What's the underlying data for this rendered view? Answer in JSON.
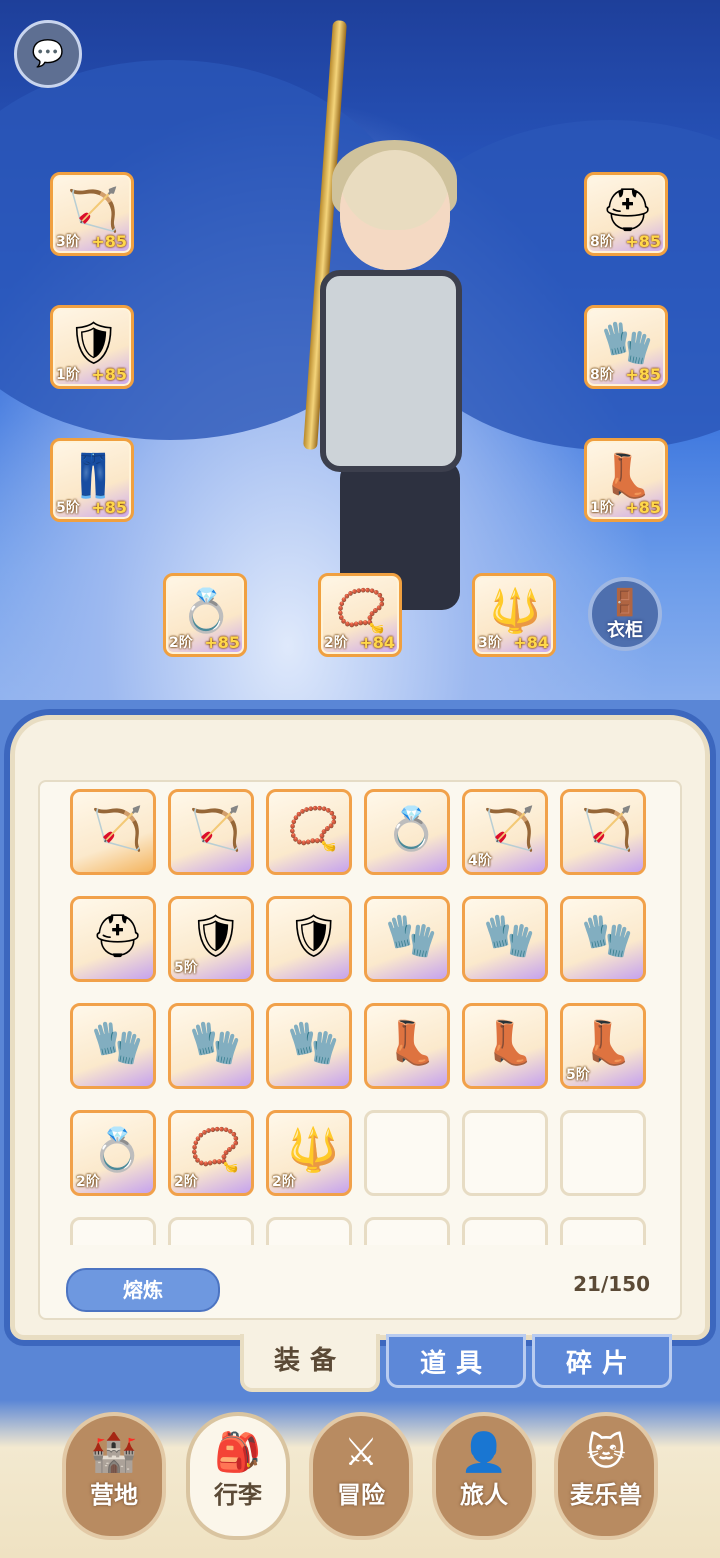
{
  "chat_icon": "chat-bubbles-icon",
  "equipped": [
    {
      "icon": "bow-icon",
      "art": "🏹",
      "tier": "3阶",
      "plus": "+85"
    },
    {
      "icon": "armor-icon",
      "art": "🛡",
      "tier": "1阶",
      "plus": "+85"
    },
    {
      "icon": "pants-icon",
      "art": "👖",
      "tier": "5阶",
      "plus": "+85"
    },
    {
      "icon": "helmet-icon",
      "art": "⛑",
      "tier": "8阶",
      "plus": "+85"
    },
    {
      "icon": "gloves-icon",
      "art": "🧤",
      "tier": "8阶",
      "plus": "+85"
    },
    {
      "icon": "boots-icon",
      "art": "👢",
      "tier": "1阶",
      "plus": "+85"
    },
    {
      "icon": "ring-icon",
      "art": "💍",
      "tier": "2阶",
      "plus": "+85"
    },
    {
      "icon": "necklace-icon",
      "art": "📿",
      "tier": "2阶",
      "plus": "+84"
    },
    {
      "icon": "earring-icon",
      "art": "🔱",
      "tier": "3阶",
      "plus": "+84"
    }
  ],
  "wardrobe": {
    "icon": "wardrobe-icon",
    "label": "衣柜"
  },
  "inventory": [
    {
      "icon": "bow-icon",
      "art": "🏹",
      "tier": ""
    },
    {
      "icon": "bow-icon",
      "art": "🏹",
      "tier": ""
    },
    {
      "icon": "necklace-icon",
      "art": "📿",
      "tier": ""
    },
    {
      "icon": "ring-icon",
      "art": "💍",
      "tier": ""
    },
    {
      "icon": "bow-icon",
      "art": "🏹",
      "tier": "4阶"
    },
    {
      "icon": "bow-icon",
      "art": "🏹",
      "tier": ""
    },
    {
      "icon": "helmet-icon",
      "art": "⛑",
      "tier": ""
    },
    {
      "icon": "armor-icon",
      "art": "🛡",
      "tier": "5阶"
    },
    {
      "icon": "armor-icon",
      "art": "🛡",
      "tier": ""
    },
    {
      "icon": "gloves-icon",
      "art": "🧤",
      "tier": ""
    },
    {
      "icon": "gloves-icon",
      "art": "🧤",
      "tier": ""
    },
    {
      "icon": "gloves-icon",
      "art": "🧤",
      "tier": ""
    },
    {
      "icon": "gloves-icon",
      "art": "🧤",
      "tier": ""
    },
    {
      "icon": "gloves-icon",
      "art": "🧤",
      "tier": ""
    },
    {
      "icon": "gloves-icon",
      "art": "🧤",
      "tier": ""
    },
    {
      "icon": "boots-icon",
      "art": "👢",
      "tier": ""
    },
    {
      "icon": "boots-icon",
      "art": "👢",
      "tier": ""
    },
    {
      "icon": "boots-icon",
      "art": "👢",
      "tier": "5阶"
    },
    {
      "icon": "ring-icon",
      "art": "💍",
      "tier": "2阶"
    },
    {
      "icon": "necklace-icon",
      "art": "📿",
      "tier": "2阶"
    },
    {
      "icon": "earring-icon",
      "art": "🔱",
      "tier": "2阶"
    }
  ],
  "smelt_label": "熔炼",
  "capacity": "21/150",
  "tabs": [
    {
      "label": "装备",
      "active": true
    },
    {
      "label": "道具",
      "active": false
    },
    {
      "label": "碎片",
      "active": false
    }
  ],
  "nav": [
    {
      "icon": "castle-icon",
      "art": "🏰",
      "label": "营地",
      "active": false
    },
    {
      "icon": "backpack-icon",
      "art": "🎒",
      "label": "行李",
      "active": true
    },
    {
      "icon": "crossed-swords-icon",
      "art": "⚔",
      "label": "冒险",
      "active": false
    },
    {
      "icon": "traveler-icon",
      "art": "👤",
      "label": "旅人",
      "active": false
    },
    {
      "icon": "cat-icon",
      "art": "🐱",
      "label": "麦乐兽",
      "active": false
    }
  ]
}
